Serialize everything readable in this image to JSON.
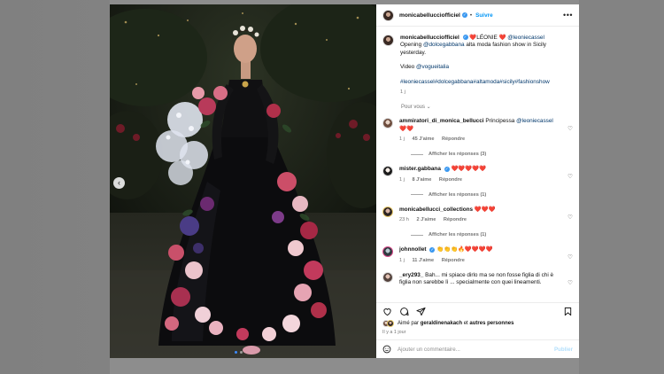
{
  "post": {
    "username": "monicabelluccìofficiel",
    "follow_label": "Suivre",
    "more_icon": "more-horizontal-icon",
    "caption": {
      "author": "monicabellucciofficiel",
      "heart_text": "❤️LÉONIE ❤️",
      "mention_leonie": "@leoniecassel",
      "line1_prefix": "Opening",
      "mention_dg": "@dolcegabbana",
      "line1_suffix": "alta moda fashion show in Sicily yesterday.",
      "video_label": "Video",
      "mention_vogue": "@vogueitalia",
      "hashtags": "#leoniecassel#dolcegabbana#altamoda#sicily#fashionshow",
      "time": "1 j"
    },
    "pour_vous": "Pour vous ⌄",
    "comments": [
      {
        "username": "ammiratori_di_monica_bellucci",
        "text": "Principessa",
        "mention": "@leoniecassel",
        "extra": "❤️❤️",
        "time": "1 j",
        "likes": "45 J'aime",
        "reply": "Répondre",
        "replies": "Afficher les réponses (3)"
      },
      {
        "username": "mister.gabbana",
        "text": "❤️❤️❤️❤️❤️",
        "time": "1 j",
        "likes": "8 J'aime",
        "reply": "Répondre",
        "replies": "Afficher les réponses (1)"
      },
      {
        "username": "monicabellucci_collections",
        "text": "❤️❤️❤️",
        "time": "23 h",
        "likes": "2 J'aime",
        "reply": "Répondre",
        "replies": "Afficher les réponses (1)"
      },
      {
        "username": "johnnollet",
        "text": "👏👏👏🔥❤️❤️❤️❤️",
        "time": "1 j",
        "likes": "11 J'aime",
        "reply": "Répondre"
      },
      {
        "username": "_ery293_",
        "text": "Bah... mi spiace dirlo ma se non fosse figlia di chi è figlia non sarebbe lì ... specialmente con quei lineamenti."
      }
    ],
    "likes": {
      "prefix": "Aimé par",
      "user": "geraldinenakach",
      "connector": "et",
      "others": "autres personnes"
    },
    "time_ago": "Il y a 1 jour",
    "comment_placeholder": "Ajouter un commentaire...",
    "publish_label": "Publier"
  },
  "colors": {
    "link": "#00376b",
    "follow": "#0095f6",
    "verified": "#3897f0",
    "publish_disabled": "#b2dffc"
  }
}
